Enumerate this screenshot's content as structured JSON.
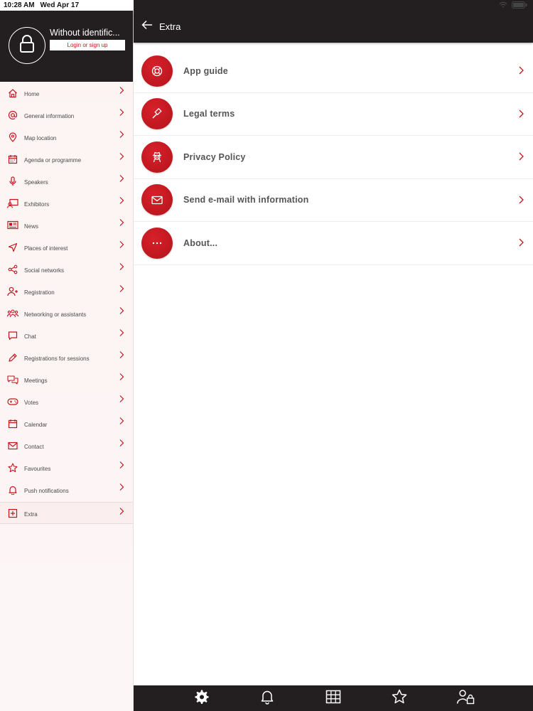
{
  "status": {
    "time": "10:28 AM",
    "date": "Wed Apr 17"
  },
  "profile": {
    "name": "Without identific...",
    "login_label": "Login or sign up"
  },
  "header": {
    "title": "Extra"
  },
  "sidebar": {
    "items": [
      {
        "label": "Home",
        "icon": "home-icon"
      },
      {
        "label": "General information",
        "icon": "at-icon"
      },
      {
        "label": "Map location",
        "icon": "map-pin-icon"
      },
      {
        "label": "Agenda or programme",
        "icon": "agenda-icon"
      },
      {
        "label": "Speakers",
        "icon": "microphone-icon"
      },
      {
        "label": "Exhibitors",
        "icon": "exhibitors-icon"
      },
      {
        "label": "News",
        "icon": "news-icon"
      },
      {
        "label": "Places of interest",
        "icon": "navigation-icon"
      },
      {
        "label": "Social networks",
        "icon": "share-icon"
      },
      {
        "label": "Registration",
        "icon": "user-plus-icon"
      },
      {
        "label": "Networking or assistants",
        "icon": "group-icon"
      },
      {
        "label": "Chat",
        "icon": "chat-icon"
      },
      {
        "label": "Registrations for sessions",
        "icon": "pen-icon"
      },
      {
        "label": "Meetings",
        "icon": "meetings-icon"
      },
      {
        "label": "Votes",
        "icon": "gamepad-icon"
      },
      {
        "label": "Calendar",
        "icon": "calendar-icon"
      },
      {
        "label": "Contact",
        "icon": "envelope-icon"
      },
      {
        "label": "Favourites",
        "icon": "star-icon"
      },
      {
        "label": "Push notifications",
        "icon": "bell-icon"
      },
      {
        "label": "Extra",
        "icon": "plus-square-icon"
      }
    ]
  },
  "main": {
    "items": [
      {
        "label": "App guide",
        "icon": "lifebuoy-icon"
      },
      {
        "label": "Legal terms",
        "icon": "gavel-icon"
      },
      {
        "label": "Privacy Policy",
        "icon": "spy-icon"
      },
      {
        "label": "Send e-mail with information",
        "icon": "envelope-icon"
      },
      {
        "label": "About...",
        "icon": "ellipsis-icon"
      }
    ]
  },
  "tabbar": {
    "icons": [
      "gear-icon",
      "bell-icon",
      "grid-icon",
      "star-icon",
      "users-lock-icon"
    ]
  },
  "colors": {
    "accent": "#c4151c",
    "dark": "#231f20",
    "sidebar_bg": "#fdf3f3"
  }
}
